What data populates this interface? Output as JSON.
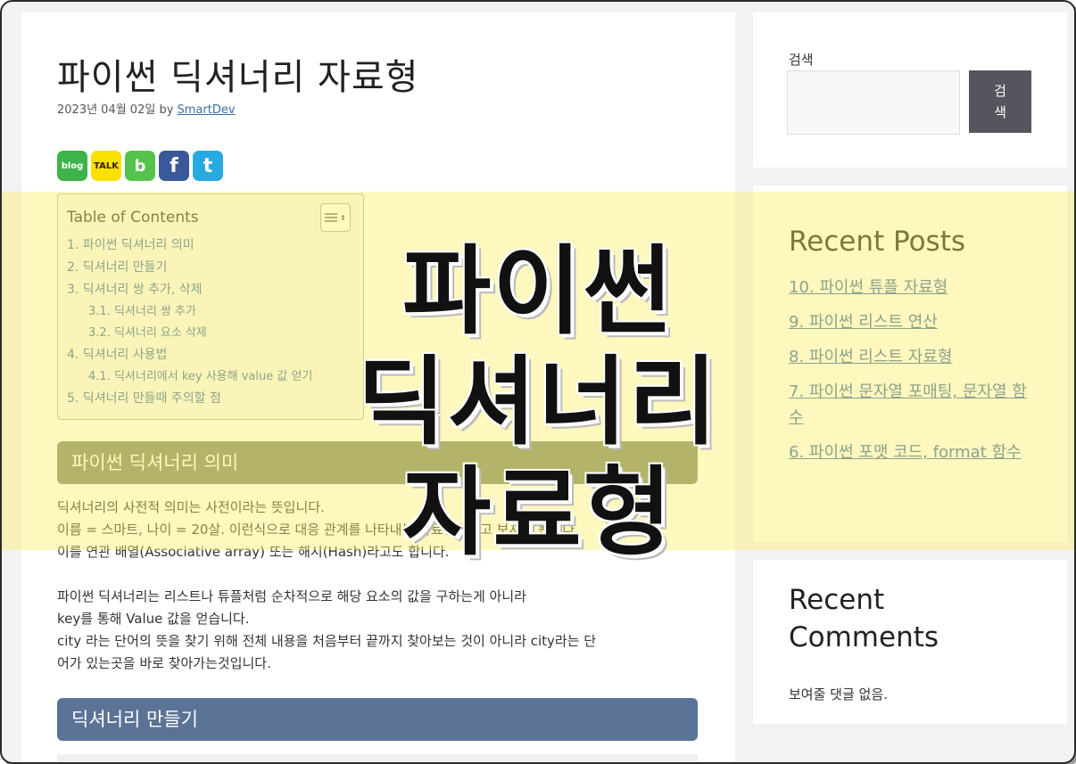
{
  "article": {
    "title": "파이썬 딕셔너리 자료형",
    "date": "2023년 04월 02일 by ",
    "author": "SmartDev"
  },
  "share_buttons": [
    {
      "label": "blog",
      "color": "#3db34a"
    },
    {
      "label": "TALK",
      "color": "#f9e000"
    },
    {
      "label": "b",
      "color": "#55c24c"
    },
    {
      "label": "f",
      "color": "#3b5998"
    },
    {
      "label": "t",
      "color": "#29a9e1"
    }
  ],
  "toc": {
    "title": "Table of Contents",
    "items": [
      "1. 파이썬 딕셔너리 의미",
      "2. 딕셔너리 만들기",
      "3. 딕셔너리 쌍 추가, 삭제",
      "3.1. 딕셔너리 쌍 추가",
      "3.2. 딕셔너리 요소 삭제",
      "4. 딕셔너리 사용법",
      "4.1. 딕셔너리에서 key 사용해 value 값 얻기",
      "5. 딕셔너리 만들때 주의할 점"
    ]
  },
  "sections": [
    {
      "heading": "파이썬 딕셔너리 의미",
      "color": "#7f8c6d"
    },
    {
      "heading": "딕셔너리 만들기",
      "color": "#5b7396"
    }
  ],
  "paragraphs": [
    "딕셔너리의 사전적 의미는 사전이라는 뜻입니다.\n이름 = 스마트, 나이 = 20살. 이런식으로 대응 관계를 나타내는 자료형이라고 보시면 됩니다.\n이를 연관 배열(Associative array) 또는 해시(Hash)라고도 합니다.",
    "파이썬 딕셔너리는 리스트나 튜플처럼 순차적으로 해당 요소의 값을 구하는게 아니라\nkey를 통해 Value 값을 얻습니다.\ncity 라는 단어의 뜻을 찾기 위해 전체 내용을 처음부터 끝까지 찾아보는 것이 아니라 city라는 단\n어가 있는곳을 바로 찾아가는것입니다."
  ],
  "sidebar": {
    "search_label": "검색",
    "search_button": "검\n색",
    "recent_posts_title": "Recent Posts",
    "recent_posts": [
      "10. 파이썬 튜플 자료형",
      "9. 파이썬 리스트 연산",
      "8. 파이썬 리스트 자료형",
      "7. 파이썬 문자열 포매팅, 문자열 함수",
      "6. 파이썬 포맷 코드, format 함수"
    ],
    "recent_comments_title": "Recent\nComments",
    "no_comments": "보여줄 댓글 없음."
  },
  "overlay": {
    "lines": [
      "파이썬",
      "딕셔너리",
      "자료형"
    ],
    "color": "#fdec64"
  }
}
